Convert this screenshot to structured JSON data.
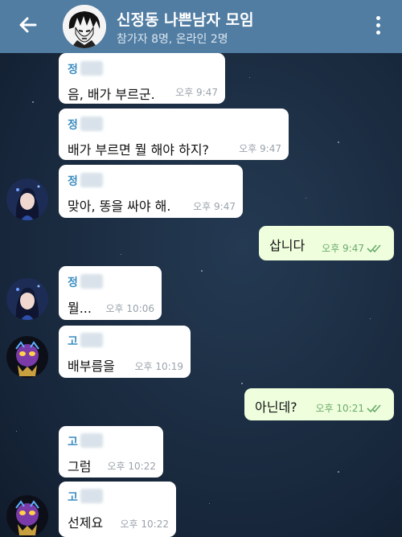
{
  "header": {
    "title": "신정동 나쁜남자 모임",
    "subtitle": "참가자 8명, 온라인 2명"
  },
  "messages": [
    {
      "sender": "정",
      "text": "음, 배가 부르군.",
      "time": "오후 9:47"
    },
    {
      "sender": "정",
      "text": "배가 부르면 뭘 해야 하지?",
      "time": "오후 9:47"
    },
    {
      "sender": "정",
      "text": "맞아, 똥을 싸야 해.",
      "time": "오후 9:47"
    },
    {
      "text": "삽니다",
      "time": "오후 9:47"
    },
    {
      "sender": "정",
      "text": "뭘...",
      "time": "오후 10:06"
    },
    {
      "sender": "고",
      "text": "배부름을",
      "time": "오후 10:19"
    },
    {
      "text": "아닌데?",
      "time": "오후 10:21"
    },
    {
      "sender": "고",
      "text": "그럼",
      "time": "오후 10:22"
    },
    {
      "sender": "고",
      "text": "선제요",
      "time": "오후 10:22"
    }
  ],
  "colors": {
    "header": "#517da2",
    "incoming_bubble": "#ffffff",
    "outgoing_bubble": "#effedd",
    "sender_name": "#3c8dc0"
  }
}
